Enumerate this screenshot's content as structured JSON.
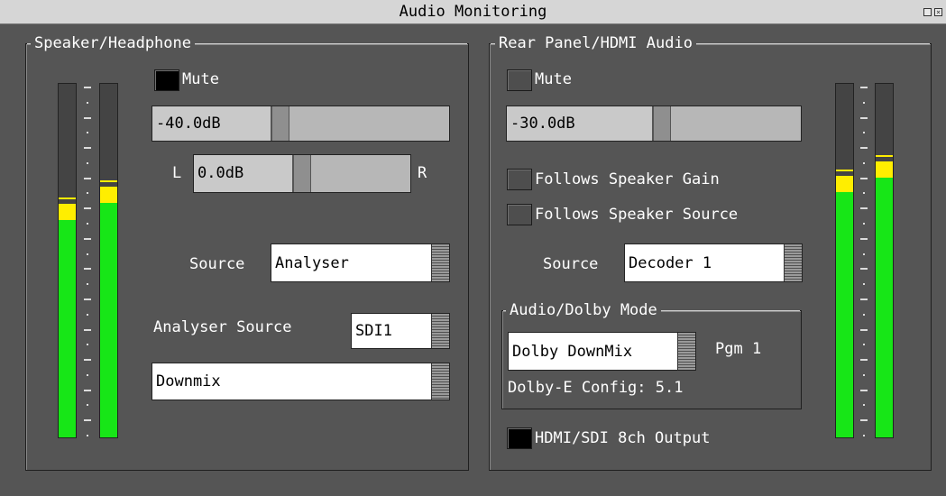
{
  "window": {
    "title": "Audio Monitoring"
  },
  "speaker": {
    "title": "Speaker/Headphone",
    "mute_label": "Mute",
    "mute_checked": true,
    "gain_value": "-40.0dB",
    "balance_left": "L",
    "balance_right": "R",
    "balance_value": "0.0dB",
    "source_label": "Source",
    "source_value": "Analyser",
    "analyser_source_label": "Analyser Source",
    "analyser_source_value": "SDI1",
    "downmix_value": "Downmix"
  },
  "rear": {
    "title": "Rear Panel/HDMI Audio",
    "mute_label": "Mute",
    "mute_checked": false,
    "gain_value": "-30.0dB",
    "follows_gain_label": "Follows Speaker Gain",
    "follows_source_label": "Follows Speaker Source",
    "source_label": "Source",
    "source_value": "Decoder 1",
    "dolby_mode_title": "Audio/Dolby Mode",
    "dolby_mode_value": "Dolby DownMix",
    "pgm_label": "Pgm 1",
    "dolby_e_config": "Dolby-E Config: 5.1",
    "hdmi_output_label": "HDMI/SDI 8ch Output",
    "hdmi_output_checked": true
  },
  "meters": {
    "colors": {
      "green": "#17e617",
      "yellow": "#ffee00",
      "background": "#444444"
    },
    "speaker_left_level": 0.66,
    "speaker_right_level": 0.71,
    "rear_left_level": 0.74,
    "rear_right_level": 0.78
  },
  "icons": [
    "maximize-icon",
    "close-icon"
  ]
}
